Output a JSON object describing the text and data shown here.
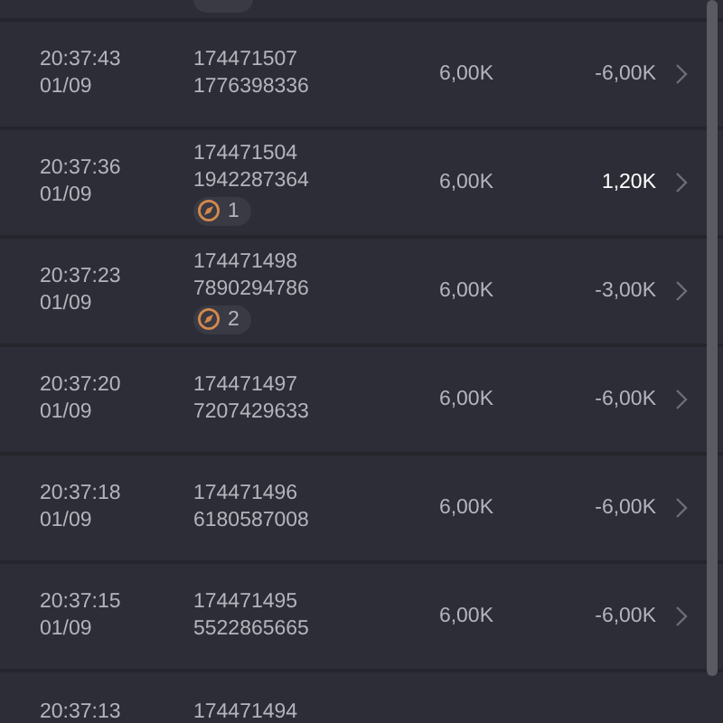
{
  "rows": [
    {
      "time": "20:37:43",
      "date": "01/09",
      "id": "174471507",
      "ref": "1776398336",
      "amount": "6,00K",
      "result": "-6,00K",
      "positive": false
    },
    {
      "time": "20:37:36",
      "date": "01/09",
      "id": "174471504",
      "ref": "1942287364",
      "badge": "1",
      "amount": "6,00K",
      "result": "1,20K",
      "positive": true
    },
    {
      "time": "20:37:23",
      "date": "01/09",
      "id": "174471498",
      "ref": "7890294786",
      "badge": "2",
      "amount": "6,00K",
      "result": "-3,00K",
      "positive": false
    },
    {
      "time": "20:37:20",
      "date": "01/09",
      "id": "174471497",
      "ref": "7207429633",
      "amount": "6,00K",
      "result": "-6,00K",
      "positive": false
    },
    {
      "time": "20:37:18",
      "date": "01/09",
      "id": "174471496",
      "ref": "6180587008",
      "amount": "6,00K",
      "result": "-6,00K",
      "positive": false
    },
    {
      "time": "20:37:15",
      "date": "01/09",
      "id": "174471495",
      "ref": "5522865665",
      "amount": "6,00K",
      "result": "-6,00K",
      "positive": false
    },
    {
      "time": "20:37:13",
      "id": "174471494",
      "cut": true
    }
  ]
}
